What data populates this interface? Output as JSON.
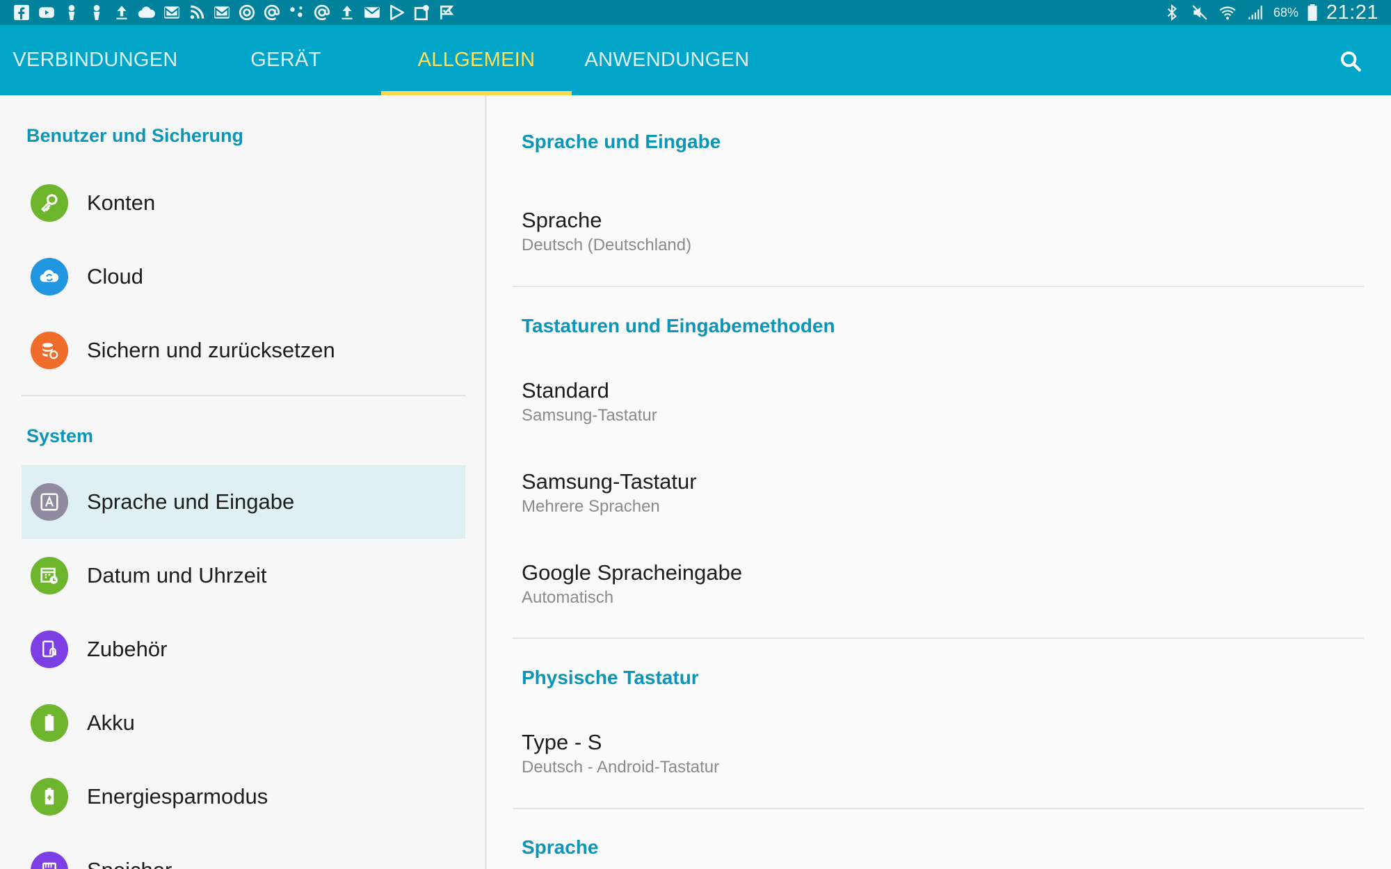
{
  "statusbar": {
    "left_icons": [
      "facebook-icon",
      "youtube-icon",
      "person-pin-icon",
      "person-pin-icon",
      "upload-icon",
      "cloud-icon",
      "gmail-icon",
      "rss-icon",
      "gmail-icon",
      "sync-icon",
      "at-sign-icon",
      "connections-icon",
      "at-sign-icon",
      "upload-icon",
      "mail-icon",
      "play-store-icon",
      "maps-icon",
      "check-flag-icon"
    ],
    "right_icons": [
      "bluetooth-icon",
      "mute-icon",
      "wifi-icon",
      "signal-icon",
      "battery-icon"
    ],
    "battery": "68%",
    "time": "21:21"
  },
  "tabs": [
    {
      "label": "VERBINDUNGEN",
      "active": false
    },
    {
      "label": "GERÄT",
      "active": false
    },
    {
      "label": "ALLGEMEIN",
      "active": true
    },
    {
      "label": "ANWENDUNGEN",
      "active": false
    }
  ],
  "colors": {
    "statusbar": "#00829d",
    "tabbar": "#00a5c8",
    "active_tab": "#ffe15a",
    "section_header": "#0b95b6",
    "selected_row": "#def0f4"
  },
  "left": {
    "sections": [
      {
        "header": "Benutzer und Sicherung",
        "items": [
          {
            "label": "Konten",
            "icon": "key-icon",
            "color": "#6cb52d"
          },
          {
            "label": "Cloud",
            "icon": "cloud-sync-icon",
            "color": "#2196e0"
          },
          {
            "label": "Sichern und zurücksetzen",
            "icon": "backup-icon",
            "color": "#ef6c2a"
          }
        ]
      },
      {
        "header": "System",
        "items": [
          {
            "label": "Sprache und Eingabe",
            "icon": "language-icon",
            "color": "#8f8aa0",
            "selected": true
          },
          {
            "label": "Datum und Uhrzeit",
            "icon": "calendar-clock-icon",
            "color": "#6cb52d"
          },
          {
            "label": "Zubehör",
            "icon": "accessory-icon",
            "color": "#7b3fe4"
          },
          {
            "label": "Akku",
            "icon": "battery-icon",
            "color": "#6cb52d"
          },
          {
            "label": "Energiesparmodus",
            "icon": "power-saving-icon",
            "color": "#6cb52d"
          },
          {
            "label": "Speicher",
            "icon": "storage-icon",
            "color": "#7b3fe4"
          }
        ]
      }
    ]
  },
  "right": {
    "sections": [
      {
        "header": "Sprache und Eingabe",
        "items": [
          {
            "title": "Sprache",
            "subtitle": "Deutsch (Deutschland)"
          }
        ]
      },
      {
        "header": "Tastaturen und Eingabemethoden",
        "items": [
          {
            "title": "Standard",
            "subtitle": "Samsung-Tastatur"
          },
          {
            "title": "Samsung-Tastatur",
            "subtitle": "Mehrere Sprachen"
          },
          {
            "title": "Google Spracheingabe",
            "subtitle": "Automatisch"
          }
        ]
      },
      {
        "header": "Physische Tastatur",
        "items": [
          {
            "title": "Type - S",
            "subtitle": "Deutsch - Android-Tastatur"
          }
        ]
      },
      {
        "header": "Sprache",
        "items": []
      }
    ]
  }
}
